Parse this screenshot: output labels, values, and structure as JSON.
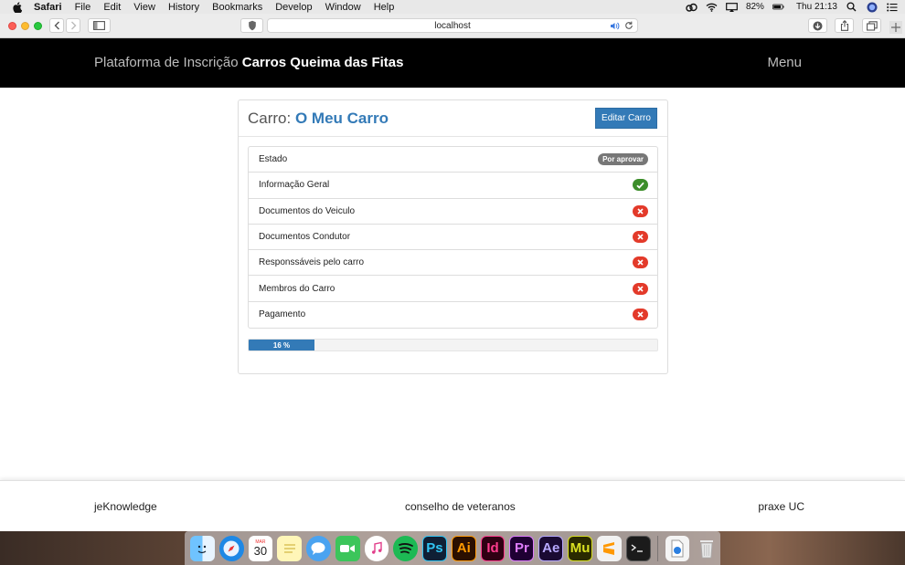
{
  "menubar": {
    "app": "Safari",
    "items": [
      "File",
      "Edit",
      "View",
      "History",
      "Bookmarks",
      "Develop",
      "Window",
      "Help"
    ],
    "battery": "82%",
    "clock": "Thu 21:13"
  },
  "browser": {
    "url": "localhost"
  },
  "header": {
    "brand_prefix": "Plataforma de Inscrição",
    "brand_name": "Carros Queima das Fitas",
    "menu_label": "Menu"
  },
  "card": {
    "title_prefix": "Carro:",
    "title_name": "O Meu Carro",
    "edit_label": "Editar Carro",
    "rows": [
      {
        "label": "Estado",
        "badge": "Por aprovar"
      },
      {
        "label": "Informação Geral",
        "status": "ok"
      },
      {
        "label": "Documentos do Veiculo",
        "status": "missing"
      },
      {
        "label": "Documentos Condutor",
        "status": "missing"
      },
      {
        "label": "Responssáveis pelo carro",
        "status": "missing"
      },
      {
        "label": "Membros do Carro",
        "status": "missing"
      },
      {
        "label": "Pagamento",
        "status": "missing"
      }
    ],
    "progress_value": 16,
    "progress_label": "16 %"
  },
  "footer": {
    "left": "jeKnowledge",
    "center": "conselho de veteranos",
    "right": "praxe UC"
  },
  "dock": {
    "calendar_day": "30",
    "calendar_month": "MAR",
    "apps": [
      "Ps",
      "Ai",
      "Id",
      "Pr",
      "Ae",
      "Mu"
    ]
  },
  "colors": {
    "primary": "#337ab7",
    "success": "#3c8e2a",
    "danger": "#e33a2a",
    "header_bg": "#000000"
  }
}
